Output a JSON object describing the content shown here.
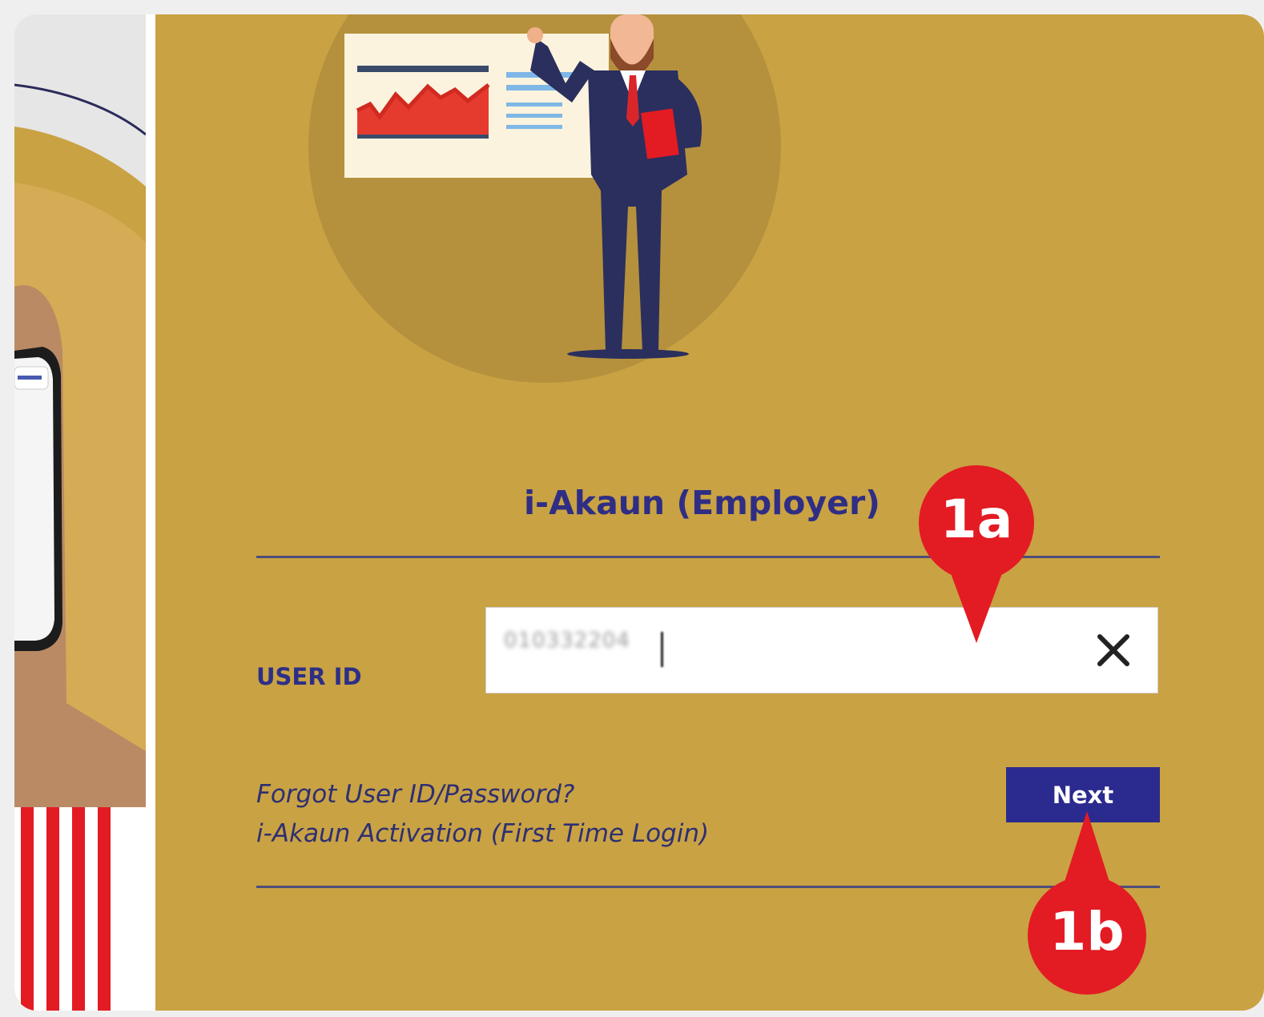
{
  "login": {
    "title": "i-Akaun (Employer)",
    "user_id_label": "USER ID",
    "user_id_value": "010332204",
    "forgot_link": "Forgot User ID/Password?",
    "activation_link": "i-Akaun Activation (First Time Login)",
    "next_button": "Next"
  },
  "annotations": {
    "marker_a": "1a",
    "marker_b": "1b"
  },
  "colors": {
    "background": "#c9a243",
    "title_text": "#2f2e84",
    "button_bg": "#2b2a8e",
    "marker_red": "#e31b23"
  },
  "icons": {
    "clear": "close-icon"
  }
}
